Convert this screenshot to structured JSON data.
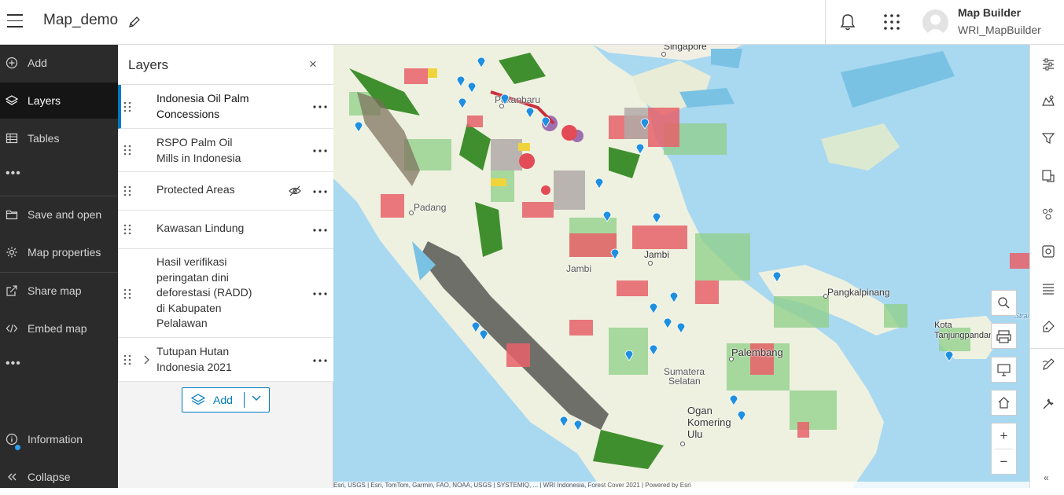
{
  "header": {
    "menu_icon": "hamburger-icon",
    "title": "Map_demo",
    "edit_icon": "pencil-icon",
    "notifications_icon": "bell-icon",
    "apps_icon": "app-grid-icon",
    "user_display_name": "Map Builder",
    "user_name": "WRI_MapBuilder"
  },
  "leftnav": {
    "items": [
      {
        "label": "Add",
        "icon": "plus-circle-icon"
      },
      {
        "label": "Layers",
        "icon": "layers-icon"
      },
      {
        "label": "Tables",
        "icon": "table-icon"
      },
      {
        "label": "Save and open",
        "icon": "folder-icon"
      },
      {
        "label": "Map properties",
        "icon": "gear-icon"
      },
      {
        "label": "Share map",
        "icon": "share-icon"
      },
      {
        "label": "Embed map",
        "icon": "code-icon"
      },
      {
        "label": "Information",
        "icon": "info-icon"
      },
      {
        "label": "Collapse",
        "icon": "double-chevron-left-icon"
      }
    ],
    "overflow": "•••",
    "active": "Layers"
  },
  "layers_panel": {
    "title": "Layers",
    "close": "×",
    "layers": [
      {
        "name_lines": [
          "Indonesia Oil Palm",
          "Concessions"
        ],
        "selected": true
      },
      {
        "name_lines": [
          "RSPO Palm Oil",
          "Mills in Indonesia"
        ]
      },
      {
        "name_lines": [
          "Protected Areas"
        ],
        "hidden": true
      },
      {
        "name_lines": [
          "Kawasan Lindung"
        ]
      },
      {
        "name_lines": [
          "Hasil verifikasi",
          "peringatan dini",
          "deforestasi (RADD)",
          "di Kabupaten",
          "Pelalawan"
        ]
      },
      {
        "name_lines": [
          "Tutupan Hutan",
          "Indonesia 2021"
        ],
        "expandable": true
      }
    ],
    "add_button": "Add"
  },
  "map": {
    "labels": {
      "singapore": "Singapore",
      "pekanbaru": "Pekanbaru",
      "jambi_city": "Jambi",
      "jambi_region": "Jambi",
      "pangkalpinang": "Pangkalpinang",
      "palembang": "Palembang",
      "sumatera_selatan_1": "Sumatera",
      "sumatera_selatan_2": "Selatan",
      "oku_1": "Ogan",
      "oku_2": "Komering",
      "oku_3": "Ulu",
      "kota_1": "Kota",
      "kota_2": "Tanjungpandan",
      "padang": "Padang",
      "straits": "Strait"
    },
    "attribution": "Esri, USGS | Esri, TomTom, Garmin, FAO, NOAA, USGS | SYSTEMIQ, ... | WRI Indonesia, Forest Cover 2021 | Powered by Esri",
    "controls": {
      "search": "search-icon",
      "print": "print-icon",
      "fullscreen": "monitor-icon",
      "home": "home-icon",
      "zoom_in": "+",
      "zoom_out": "−"
    }
  },
  "rightbar": {
    "tools": [
      "properties-icon",
      "styles-icon",
      "filter-icon",
      "effects-icon",
      "aggregation-icon",
      "clustering-icon",
      "labels-icon",
      "configure-pop-ups-icon",
      "sketch-icon",
      "measure-icon"
    ],
    "collapse": "«"
  }
}
